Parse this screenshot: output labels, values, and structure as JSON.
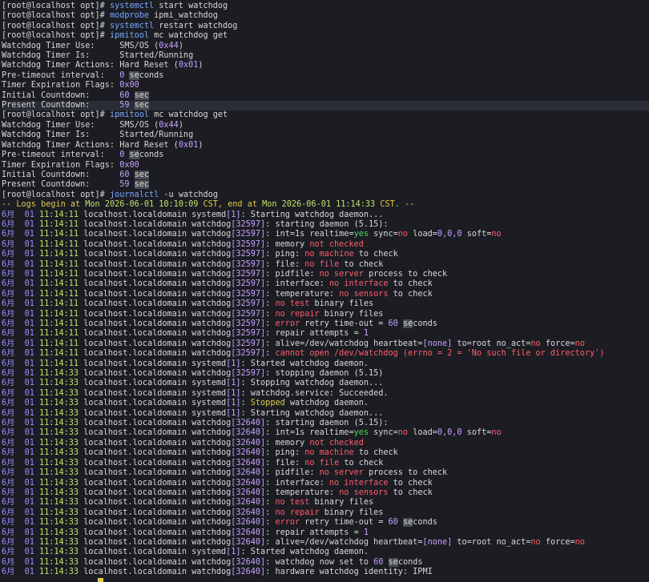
{
  "prompt": "[root@localhost opt]# ",
  "cmd1": {
    "cmd": "systemctl",
    "args": " start watchdog"
  },
  "cmd2": {
    "cmd": "modprobe",
    "args": " ipmi_watchdog"
  },
  "cmd3": {
    "cmd": "systemctl",
    "args": " restart watchdog"
  },
  "cmd4": {
    "cmd": "ipmitool",
    "args": " mc watchdog get"
  },
  "wd1": {
    "use_label": "Watchdog Timer Use:     ",
    "use_val": "SMS/OS (",
    "use_code": "0x44",
    "close": ")",
    "is_label": "Watchdog Timer Is:      ",
    "is_val": "Started/Running",
    "act_label": "Watchdog Timer Actions: ",
    "act_val": "Hard Reset (",
    "act_code": "0x01",
    "pre_label": "Pre-timeout interval:   ",
    "pre_val": "0",
    "pre_unit_a": " ",
    "pre_unit_hl": "se",
    "pre_unit_b": "conds",
    "flags_label": "Timer Expiration Flags: ",
    "flags_val": "0x00",
    "init_label": "Initial Countdown:      ",
    "init_val": "60",
    "init_unit": "sec",
    "pres_label": "Present Countdown:      ",
    "pres_val": "59",
    "pres_unit": "sec"
  },
  "cmd5": {
    "cmd": "ipmitool",
    "args": " mc watchdog get"
  },
  "wd2": {
    "init_val": "60",
    "pres_val": "59"
  },
  "cmd6": {
    "cmd": "journalctl",
    "args": " -u watchdog"
  },
  "journal_header": {
    "a": "-- Logs begin at ",
    "b": "Mon 2026-06-01 10:10:09",
    "c": " CST, end at ",
    "d": "Mon 2026-06-01 11:14:33",
    "e": " CST. --"
  },
  "month_day": "6月  01 ",
  "host": " localhost.localdomain ",
  "t1": "11:14:11",
  "t2": "11:14:33",
  "log": {
    "l1": ": Starting watchdog daemon...",
    "starting": ": starting daemon (5.15):",
    "int_a": ": int=1s realtime=",
    "yes": "yes",
    "int_b": " sync=",
    "no": "no",
    "int_c": " load=",
    "load": "0,0,0",
    "int_d": " soft=",
    "memory_a": ": memory ",
    "not_checked": "not checked",
    "ping_a": ": ping: ",
    "no_machine": "no machine",
    "to_check": " to check",
    "file_a": ": file: ",
    "no_file": "no file",
    "pidfile_a": ": pidfile: ",
    "no_server": "no server",
    "process": " process to check",
    "iface_a": ": interface: ",
    "no_iface": "no interface",
    "temp_a": ": temperature: ",
    "no_sensors": "no sensors",
    "no_test": "no test",
    "binary": " binary files",
    "no_repair": "no repair",
    "error": "error",
    "retry": " retry time-out = ",
    "sixty": "60",
    "sec_hl": "se",
    "sec_b": "conds",
    "repair_a": ": repair attempts = ",
    "one": "1",
    "alive_a": ": alive=/dev/watchdog heartbeat=",
    "none": "[none]",
    "alive_b": " to=root no_act=",
    "alive_c": " force=",
    "cannot": "cannot open /dev/watchdog (errno = 2 = 'No such file or directory')",
    "started": ": Started watchdog daemon.",
    "stopping": ": stopping daemon (5.15)",
    "stopping_daemon": ": Stopping watchdog daemon...",
    "succeeded": ": watchdog.service: Succeeded.",
    "stopped_a": ": ",
    "stopped": "Stopped",
    "stopped_b": " watchdog daemon.",
    "starting_daemon": ": Starting watchdog daemon...",
    "now_set_a": ": watchdog now set to ",
    "now_set_b": " ",
    "now_set_c": "conds",
    "hw_identity": ": hardware watchdog identity: IPMI"
  },
  "systemd": "systemd",
  "watchdog": "watchdog",
  "pid1": "[1]",
  "pid_a": "[32597]",
  "pid_b": "[32640]"
}
